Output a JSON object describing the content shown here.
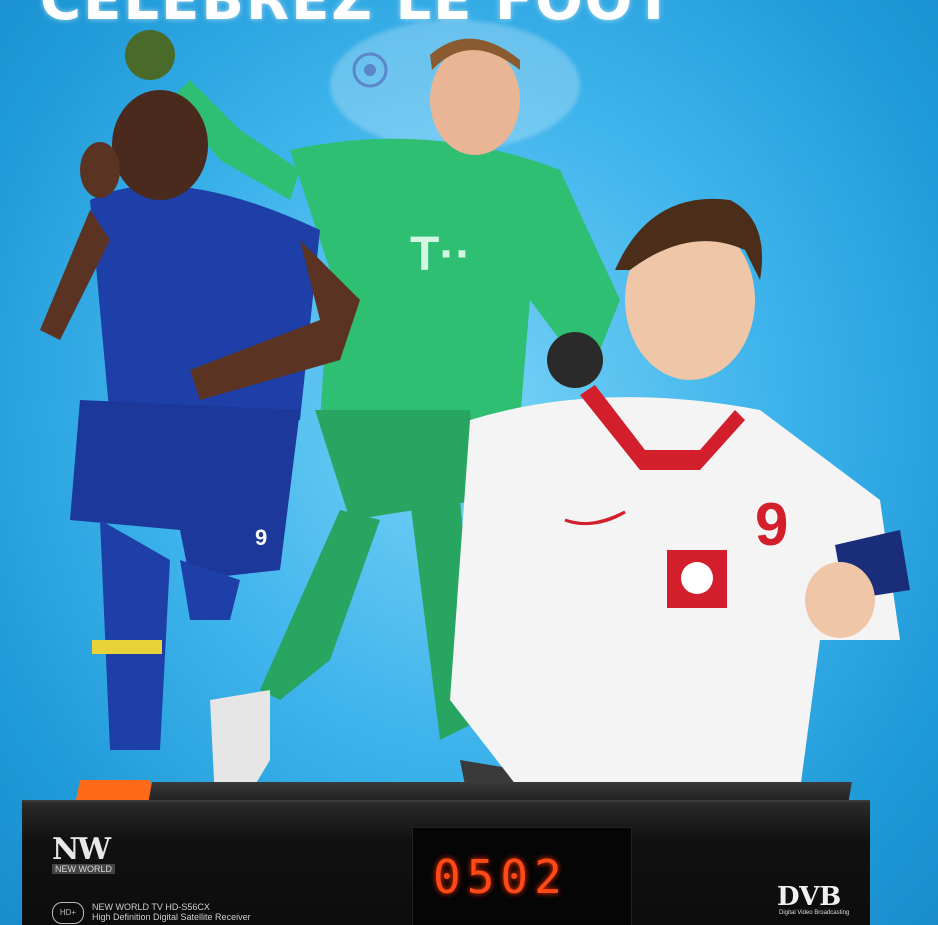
{
  "headline": "CÉLÉBREZ LE FOOT",
  "players": [
    {
      "shirt_number": "9"
    },
    {
      "shirt_sponsor": "T··"
    },
    {
      "shirt_number": "9"
    }
  ],
  "receiver": {
    "brand_logo": "NW",
    "brand_name": "NEW WORLD",
    "hd_badge": "HD+",
    "model_line_1": "NEW WORLD TV HD-S56CX",
    "model_line_2": "High Definition Digital Satellite Receiver",
    "display_digits": "0502",
    "dvb_logo": "DVB",
    "dvb_sub": "Digital Video Broadcasting",
    "top_brand": "NW"
  },
  "colors": {
    "background": "#3fb4ec",
    "chelsea_blue": "#1e3fa8",
    "goalkeeper_green": "#2fbf72",
    "poland_white": "#f4f4f4",
    "poland_red": "#d21f2b",
    "display_orange": "#ff4a17"
  }
}
